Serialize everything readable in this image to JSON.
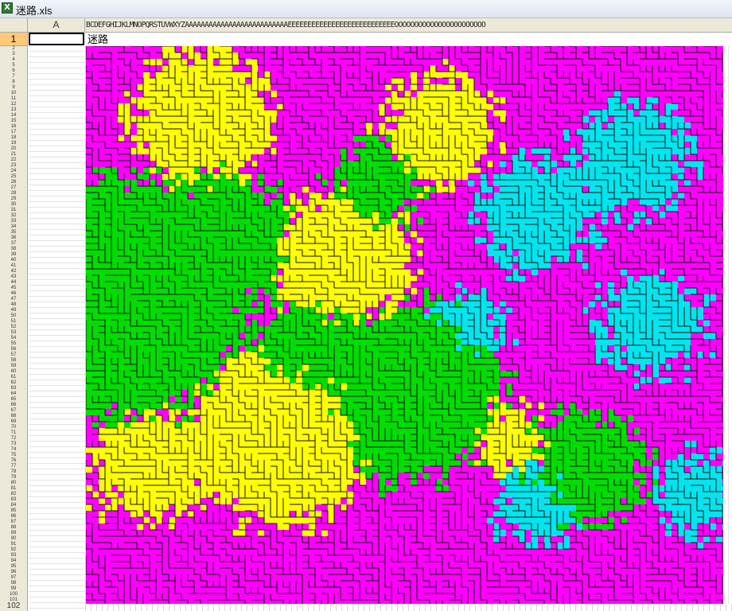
{
  "window": {
    "title": "迷路.xls",
    "app_icon": "excel-icon"
  },
  "sheet": {
    "name_box_value": "",
    "selected_row_label": "1",
    "column_a_label": "A",
    "column_letters": "BCDEFGHIJKLMNOPQRSTUVWXYZAAAAAAAAAAAAAAAAAAAAAAAAAAEEEEEEEEEEEEEEEEEEEEEEEEEEEOOOOOOOOOOOOOOOOOOOOOOO",
    "row_labels": [
      "2",
      "3",
      "4",
      "5",
      "6",
      "7",
      "8",
      "9",
      "10",
      "11",
      "12",
      "13",
      "14",
      "15",
      "16",
      "17",
      "18",
      "19",
      "20",
      "21",
      "22",
      "23",
      "24",
      "25",
      "26",
      "27",
      "28",
      "29",
      "30",
      "31",
      "32",
      "33",
      "34",
      "35",
      "36",
      "37",
      "38",
      "39",
      "40",
      "41",
      "42",
      "43",
      "44",
      "45",
      "46",
      "47",
      "48",
      "49",
      "50",
      "51",
      "52",
      "53",
      "54",
      "55",
      "56",
      "57",
      "58",
      "59",
      "60",
      "61",
      "62",
      "63",
      "64",
      "65",
      "66",
      "67",
      "68",
      "69",
      "70",
      "71",
      "72",
      "73",
      "74",
      "75",
      "76",
      "77",
      "78",
      "79",
      "80",
      "81",
      "82",
      "83",
      "84",
      "85",
      "86",
      "87",
      "88",
      "89",
      "90",
      "91",
      "92",
      "93",
      "94",
      "95",
      "96",
      "97",
      "98",
      "99",
      "100",
      "101"
    ],
    "last_row_label": "102",
    "cell_b1_text": "迷路"
  },
  "maze": {
    "colors": {
      "magenta": "#ff00ff",
      "yellow": "#ffff00",
      "green": "#00dd00",
      "cyan": "#00e5ee",
      "wall": "#111111"
    }
  }
}
